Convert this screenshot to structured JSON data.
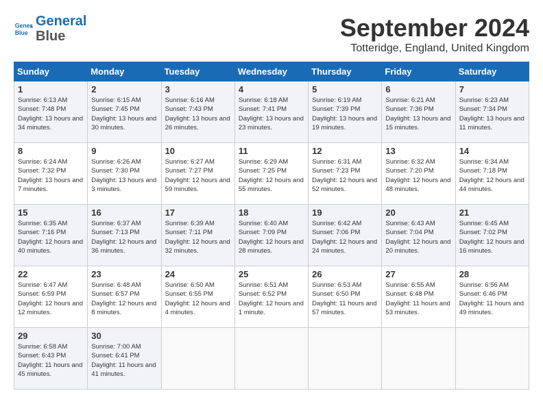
{
  "header": {
    "logo_line1": "General",
    "logo_line2": "Blue",
    "month_year": "September 2024",
    "location": "Totteridge, England, United Kingdom"
  },
  "days_of_week": [
    "Sunday",
    "Monday",
    "Tuesday",
    "Wednesday",
    "Thursday",
    "Friday",
    "Saturday"
  ],
  "weeks": [
    [
      {
        "day": "1",
        "sunrise": "6:13 AM",
        "sunset": "7:48 PM",
        "daylight": "13 hours and 34 minutes."
      },
      {
        "day": "2",
        "sunrise": "6:15 AM",
        "sunset": "7:45 PM",
        "daylight": "13 hours and 30 minutes."
      },
      {
        "day": "3",
        "sunrise": "6:16 AM",
        "sunset": "7:43 PM",
        "daylight": "13 hours and 26 minutes."
      },
      {
        "day": "4",
        "sunrise": "6:18 AM",
        "sunset": "7:41 PM",
        "daylight": "13 hours and 23 minutes."
      },
      {
        "day": "5",
        "sunrise": "6:19 AM",
        "sunset": "7:39 PM",
        "daylight": "13 hours and 19 minutes."
      },
      {
        "day": "6",
        "sunrise": "6:21 AM",
        "sunset": "7:36 PM",
        "daylight": "13 hours and 15 minutes."
      },
      {
        "day": "7",
        "sunrise": "6:23 AM",
        "sunset": "7:34 PM",
        "daylight": "13 hours and 11 minutes."
      }
    ],
    [
      {
        "day": "8",
        "sunrise": "6:24 AM",
        "sunset": "7:32 PM",
        "daylight": "13 hours and 7 minutes."
      },
      {
        "day": "9",
        "sunrise": "6:26 AM",
        "sunset": "7:30 PM",
        "daylight": "13 hours and 3 minutes."
      },
      {
        "day": "10",
        "sunrise": "6:27 AM",
        "sunset": "7:27 PM",
        "daylight": "12 hours and 59 minutes."
      },
      {
        "day": "11",
        "sunrise": "6:29 AM",
        "sunset": "7:25 PM",
        "daylight": "12 hours and 55 minutes."
      },
      {
        "day": "12",
        "sunrise": "6:31 AM",
        "sunset": "7:23 PM",
        "daylight": "12 hours and 52 minutes."
      },
      {
        "day": "13",
        "sunrise": "6:32 AM",
        "sunset": "7:20 PM",
        "daylight": "12 hours and 48 minutes."
      },
      {
        "day": "14",
        "sunrise": "6:34 AM",
        "sunset": "7:18 PM",
        "daylight": "12 hours and 44 minutes."
      }
    ],
    [
      {
        "day": "15",
        "sunrise": "6:35 AM",
        "sunset": "7:16 PM",
        "daylight": "12 hours and 40 minutes."
      },
      {
        "day": "16",
        "sunrise": "6:37 AM",
        "sunset": "7:13 PM",
        "daylight": "12 hours and 36 minutes."
      },
      {
        "day": "17",
        "sunrise": "6:39 AM",
        "sunset": "7:11 PM",
        "daylight": "12 hours and 32 minutes."
      },
      {
        "day": "18",
        "sunrise": "6:40 AM",
        "sunset": "7:09 PM",
        "daylight": "12 hours and 28 minutes."
      },
      {
        "day": "19",
        "sunrise": "6:42 AM",
        "sunset": "7:06 PM",
        "daylight": "12 hours and 24 minutes."
      },
      {
        "day": "20",
        "sunrise": "6:43 AM",
        "sunset": "7:04 PM",
        "daylight": "12 hours and 20 minutes."
      },
      {
        "day": "21",
        "sunrise": "6:45 AM",
        "sunset": "7:02 PM",
        "daylight": "12 hours and 16 minutes."
      }
    ],
    [
      {
        "day": "22",
        "sunrise": "6:47 AM",
        "sunset": "6:59 PM",
        "daylight": "12 hours and 12 minutes."
      },
      {
        "day": "23",
        "sunrise": "6:48 AM",
        "sunset": "6:57 PM",
        "daylight": "12 hours and 8 minutes."
      },
      {
        "day": "24",
        "sunrise": "6:50 AM",
        "sunset": "6:55 PM",
        "daylight": "12 hours and 4 minutes."
      },
      {
        "day": "25",
        "sunrise": "6:51 AM",
        "sunset": "6:52 PM",
        "daylight": "12 hours and 1 minute."
      },
      {
        "day": "26",
        "sunrise": "6:53 AM",
        "sunset": "6:50 PM",
        "daylight": "11 hours and 57 minutes."
      },
      {
        "day": "27",
        "sunrise": "6:55 AM",
        "sunset": "6:48 PM",
        "daylight": "11 hours and 53 minutes."
      },
      {
        "day": "28",
        "sunrise": "6:56 AM",
        "sunset": "6:46 PM",
        "daylight": "11 hours and 49 minutes."
      }
    ],
    [
      {
        "day": "29",
        "sunrise": "6:58 AM",
        "sunset": "6:43 PM",
        "daylight": "11 hours and 45 minutes."
      },
      {
        "day": "30",
        "sunrise": "7:00 AM",
        "sunset": "6:41 PM",
        "daylight": "11 hours and 41 minutes."
      },
      null,
      null,
      null,
      null,
      null
    ]
  ]
}
